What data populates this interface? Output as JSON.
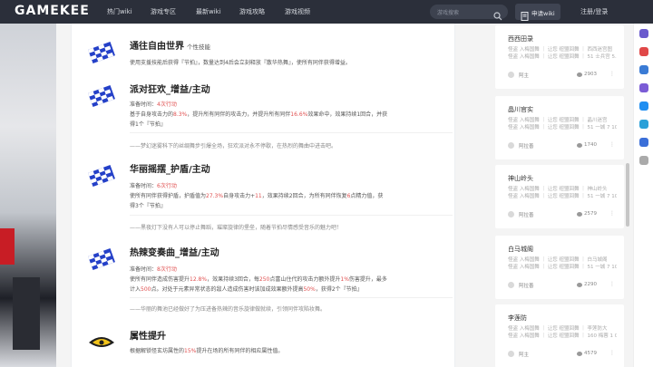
{
  "header": {
    "logo": "GAMEKEE",
    "nav": [
      "热门wiki",
      "游戏专区",
      "最新wiki",
      "游戏攻略",
      "游戏视频"
    ],
    "search_placeholder": "游戏搜索",
    "apply_label": "申请wiki",
    "login_label": "注册/登录"
  },
  "skills": [
    {
      "title": "通往自由世界",
      "tag": "个性技能",
      "lines": [
        [
          {
            "t": "使用支援技能后获得『节拍』，数量达到4后会立刻释放『散华热舞』，使所有同伴获得增益。"
          }
        ]
      ],
      "quote": ""
    },
    {
      "title": "派对狂欢_增益/主动",
      "tag": "",
      "lines": [
        [
          {
            "t": "准备时间："
          },
          {
            "t": "4次行动",
            "h": true
          }
        ],
        [
          {
            "t": "基于自身攻击力的"
          },
          {
            "t": "8.3%",
            "h": true
          },
          {
            "t": "，提升所有同伴的攻击力，并提升所有同伴"
          },
          {
            "t": "16.6%",
            "h": true
          },
          {
            "t": "效果命中，效果持续1回合，并获"
          }
        ],
        [
          {
            "t": "得1个『节拍』"
          }
        ]
      ],
      "quote": "——梦幻迷雾科下的丝绸舞步引爆全场，狂欢派对永不停歇，在热烈的舞曲中进击吧。"
    },
    {
      "title": "华丽摇摆_护盾/主动",
      "tag": "",
      "lines": [
        [
          {
            "t": "准备时间："
          },
          {
            "t": "6次行动",
            "h": true
          }
        ],
        [
          {
            "t": "使所有同伴获得护盾，护盾值为"
          },
          {
            "t": "27.3%",
            "h": true
          },
          {
            "t": "自身攻击力+"
          },
          {
            "t": "11",
            "h": true
          },
          {
            "t": "，效果持续2回合，为所有同伴恢复"
          },
          {
            "t": "6",
            "h": true
          },
          {
            "t": "点精力值，获"
          }
        ],
        [
          {
            "t": "得3个『节拍』"
          }
        ]
      ],
      "quote": "——黑夜灯下没有人可以停止舞蹈，璀璨旋律的堡垒，随着节拍尽情感受音乐的魅力吧！"
    },
    {
      "title": "热辣变奏曲_增益/主动",
      "tag": "",
      "lines": [
        [
          {
            "t": "准备时间："
          },
          {
            "t": "8次行动",
            "h": true
          }
        ],
        [
          {
            "t": "使所有同伴造成伤害提升"
          },
          {
            "t": "12.8%",
            "h": true
          },
          {
            "t": "，效果持续3回合，每"
          },
          {
            "t": "250",
            "h": true
          },
          {
            "t": "点富山住代的攻击力额外提升"
          },
          {
            "t": "1%",
            "h": true
          },
          {
            "t": "伤害提升，最多"
          }
        ],
        [
          {
            "t": "计入"
          },
          {
            "t": "500",
            "h": true
          },
          {
            "t": "点。对处于元素异常状态的敌人造成伤害时该加成效果额外提高"
          },
          {
            "t": "50%",
            "h": true
          },
          {
            "t": "，获得2个『节拍』"
          }
        ]
      ],
      "quote": "——华丽的舞池已经做好了为压进备热辣的音乐旋律做就续，引领同伴攻陷妆舞。"
    },
    {
      "title": "属性提升",
      "tag": "",
      "lines": [
        [
          {
            "t": "根据解锁怪玄坊属性的"
          },
          {
            "t": "15%",
            "h": true
          },
          {
            "t": "提升在场的所有同伴的相应属性值。"
          }
        ]
      ],
      "quote": ""
    }
  ],
  "sidebar": {
    "cards": [
      {
        "title": "西西田录",
        "desc": [
          "怪盗 入梅国舞 ｜ 让您 纽盟回舞 ｜ 西西迷宫图",
          "怪盗 入梅国舞 ｜ 让您 纽盟回舞 ｜ 51 士兵宫 5. 1"
        ],
        "author": "阿主",
        "views": "2903"
      },
      {
        "title": "晶川官实",
        "desc": [
          "怪盗 入梅国舞 ｜ 让您 纽盟回舞 ｜ 晶川迷宫",
          "怪盗 入梅国舞 ｜ 让您 纽盟回舞 ｜ 51 一城 7 101"
        ],
        "author": "阿拉善",
        "views": "1740"
      },
      {
        "title": "神山岭头",
        "desc": [
          "怪盗 入梅国舞 ｜ 让您 纽盟回舞 ｜ 神山岭头",
          "怪盗 入梅国舞 ｜ 让您 纽盟回舞 ｜ 51 一城 7 101"
        ],
        "author": "阿拉善",
        "views": "2579"
      },
      {
        "title": "白马城阁",
        "desc": [
          "怪盗 入梅国舞 ｜ 让您 纽盟回舞 ｜ 白马城阁",
          "怪盗 入梅国舞 ｜ 让您 纽盟回舞 ｜ 51 一城 7 101"
        ],
        "author": "阿拉善",
        "views": "2290"
      },
      {
        "title": "李莲防",
        "desc": [
          "怪盗 入梅国舞 ｜ 让您 纽盟回舞 ｜ 李莲防大",
          "怪盗 入梅国舞 ｜ 让您 纽盟回舞 ｜ 160 梅蓉 1 0"
        ],
        "author": "阿主",
        "views": "4579"
      }
    ]
  },
  "colors": {
    "topbar": "#2b2f3a",
    "highlight": "#e05050",
    "skill_icon": "#2440c8"
  }
}
